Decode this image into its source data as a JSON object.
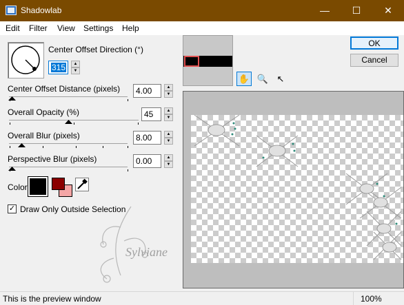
{
  "window": {
    "title": "Shadowlab",
    "minimize": "—",
    "maximize": "☐",
    "close": "✕"
  },
  "menu": [
    "Edit",
    "Filter",
    "View",
    "Settings",
    "Help"
  ],
  "controls": {
    "direction": {
      "label": "Center Offset Direction (°)",
      "value": "315"
    },
    "distance": {
      "label": "Center Offset Distance (pixels)",
      "value": "4.00"
    },
    "opacity": {
      "label": "Overall Opacity (%)",
      "value": "45"
    },
    "blur": {
      "label": "Overall Blur (pixels)",
      "value": "8.00"
    },
    "perspective": {
      "label": "Perspective Blur (pixels)",
      "value": "0.00"
    },
    "color_label": "Color",
    "shadow_color": "#000000",
    "accent_color": "#8b0000",
    "secondary_color": "#f4a6a6",
    "draw_outside": {
      "label": "Draw Only Outside Selection",
      "checked": true
    }
  },
  "buttons": {
    "ok": "OK",
    "cancel": "Cancel"
  },
  "watermark": "Sylviane",
  "status": {
    "text": "This is the preview window",
    "zoom": "100%"
  },
  "colors": {
    "titlebar": "#7a4a00",
    "selection": "#0078d7"
  }
}
